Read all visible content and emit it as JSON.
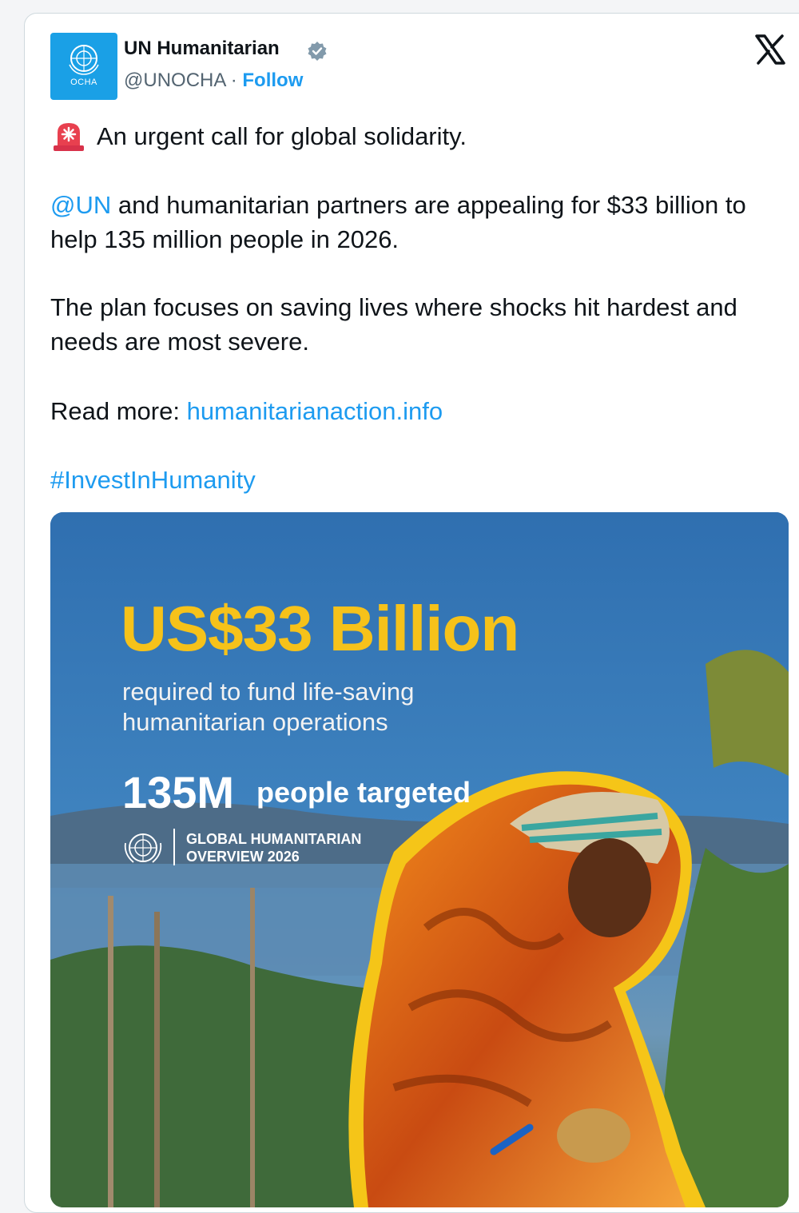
{
  "author": {
    "display_name": "UN Humanitarian",
    "handle": "@UNOCHA",
    "separator": " · ",
    "follow_label": "Follow",
    "avatar_text": "OCHA",
    "verified": true
  },
  "tweet": {
    "line1": "An urgent call for global solidarity.",
    "mention": "@UN",
    "line2_rest": " and humanitarian partners are appealing for $33 billion to help 135 million people in 2026.",
    "line3": "The plan focuses on saving lives where shocks hit hardest and needs are most severe.",
    "read_more_prefix": "Read more: ",
    "read_more_link": "humanitarianaction.info",
    "hashtag": "#InvestInHumanity"
  },
  "media": {
    "headline": "US$33 Billion",
    "subline": "required to fund life-saving humanitarian operations",
    "count": "135M",
    "count_label": "people targeted",
    "gho_line1": "GLOBAL HUMANITARIAN",
    "gho_line2": "OVERVIEW 2026"
  },
  "colors": {
    "link": "#1d9bf0",
    "headline": "#f6c21a",
    "avatar_bg": "#1aa0e6"
  }
}
